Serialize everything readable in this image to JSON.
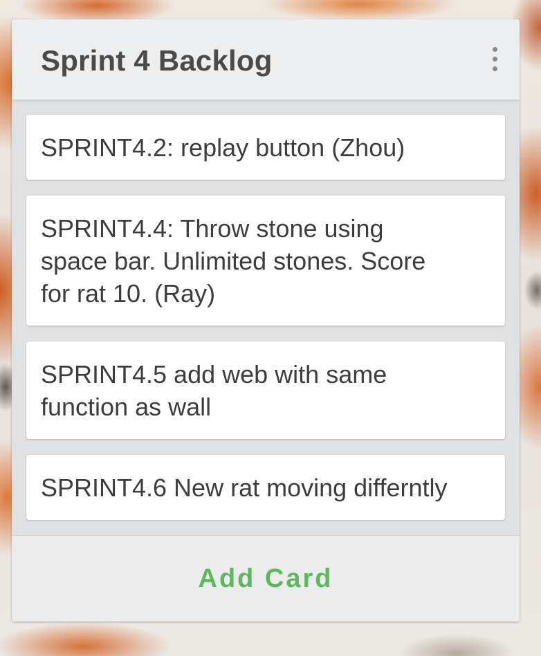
{
  "list": {
    "title": "Sprint 4 Backlog",
    "menu_icon": "more-vertical-icon",
    "cards": [
      {
        "text": "SPRINT4.2: replay button (Zhou)"
      },
      {
        "text": "SPRINT4.4: Throw stone using\nspace bar. Unlimited stones. Score\nfor rat 10. (Ray)"
      },
      {
        "text": "SPRINT4.5 add web with same\nfunction as wall"
      },
      {
        "text": "SPRINT4.6 New rat moving differntly"
      }
    ],
    "add_card_label": "Add Card"
  },
  "colors": {
    "accent": "#5cb85c",
    "title_text": "#4a4a4a",
    "card_text": "#3d3d3d",
    "list_background": "#dfe1e3",
    "card_background": "#ffffff"
  }
}
